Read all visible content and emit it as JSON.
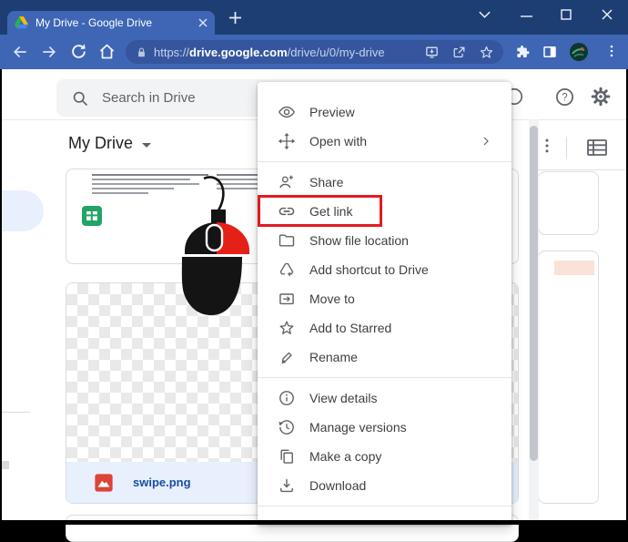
{
  "browser": {
    "tab_title": "My Drive - Google Drive",
    "url": {
      "protocol": "https://",
      "domain": "drive.google.com",
      "path": "/drive/u/0/my-drive"
    },
    "window_controls": [
      "chevron-down",
      "minimize",
      "maximize",
      "close"
    ],
    "toolbar_icons": [
      "back",
      "forward",
      "reload",
      "home",
      "lock",
      "install",
      "share-page",
      "bookmark-star",
      "extensions-puzzle",
      "side-panel",
      "profile-avatar",
      "browser-menu"
    ]
  },
  "drive": {
    "search_placeholder": "Search in Drive",
    "location_title": "My Drive",
    "header_icons": [
      "offline-status-icon",
      "help-icon",
      "settings-gear-icon"
    ],
    "view_icons": [
      "more-options-icon",
      "list-view-icon"
    ],
    "selected_file": {
      "name": "swipe.png",
      "type_icon": "image-file-icon"
    },
    "spreadsheet_card_icon": "sheets-file-icon"
  },
  "context_menu": {
    "items": [
      {
        "label": "Preview",
        "icon": "eye-icon"
      },
      {
        "label": "Open with",
        "icon": "open-with-icon",
        "has_submenu": true
      },
      {
        "label": "Share",
        "icon": "person-add-icon"
      },
      {
        "label": "Get link",
        "icon": "link-icon",
        "highlighted": true
      },
      {
        "label": "Show file location",
        "icon": "folder-icon"
      },
      {
        "label": "Add shortcut to Drive",
        "icon": "drive-shortcut-icon"
      },
      {
        "label": "Move to",
        "icon": "move-to-icon"
      },
      {
        "label": "Add to Starred",
        "icon": "star-icon"
      },
      {
        "label": "Rename",
        "icon": "rename-pencil-icon"
      },
      {
        "label": "View details",
        "icon": "info-icon"
      },
      {
        "label": "Manage versions",
        "icon": "history-icon"
      },
      {
        "label": "Make a copy",
        "icon": "copy-icon"
      },
      {
        "label": "Download",
        "icon": "download-icon"
      }
    ]
  },
  "colors": {
    "title_bar": "#1d3e73",
    "toolbar": "#3f66b5",
    "url_bar": "#35569e",
    "highlight_red": "#e21b22",
    "selection_blue": "#e8f0fe",
    "sheets_green": "#21a464",
    "image_icon_red": "#db4437",
    "icon_gray": "#5f6368"
  }
}
